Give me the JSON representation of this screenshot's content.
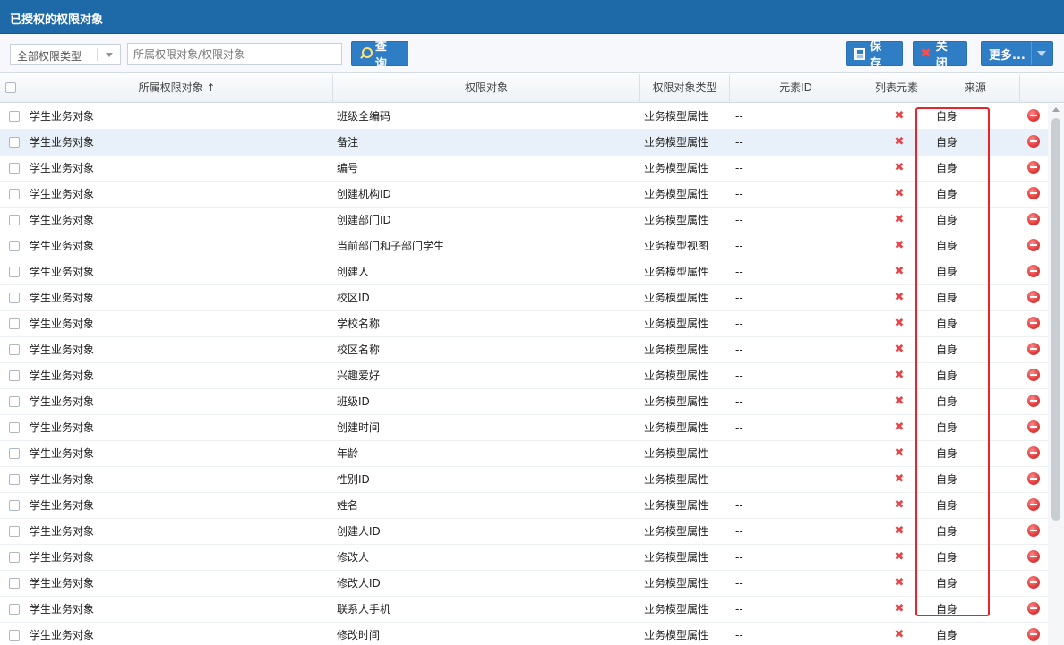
{
  "panel": {
    "title": "已授权的权限对象"
  },
  "toolbar": {
    "filter_select_value": "全部权限类型",
    "search_placeholder": "所属权限对象/权限对象",
    "query_label": "查 询",
    "save_label": "保 存",
    "close_label": "关 闭",
    "more_label": "更多..."
  },
  "columns": {
    "owner": "所属权限对象 ↑",
    "object": "权限对象",
    "type": "权限对象类型",
    "element_id": "元素ID",
    "list_element": "列表元素",
    "source": "来源"
  },
  "rows": [
    {
      "owner": "学生业务对象",
      "object": "班级全编码",
      "type": "业务模型属性",
      "element_id": "--",
      "list_element": "✖",
      "source": "自身"
    },
    {
      "owner": "学生业务对象",
      "object": "备注",
      "type": "业务模型属性",
      "element_id": "--",
      "list_element": "✖",
      "source": "自身"
    },
    {
      "owner": "学生业务对象",
      "object": "编号",
      "type": "业务模型属性",
      "element_id": "--",
      "list_element": "✖",
      "source": "自身"
    },
    {
      "owner": "学生业务对象",
      "object": "创建机构ID",
      "type": "业务模型属性",
      "element_id": "--",
      "list_element": "✖",
      "source": "自身"
    },
    {
      "owner": "学生业务对象",
      "object": "创建部门ID",
      "type": "业务模型属性",
      "element_id": "--",
      "list_element": "✖",
      "source": "自身"
    },
    {
      "owner": "学生业务对象",
      "object": "当前部门和子部门学生",
      "type": "业务模型视图",
      "element_id": "--",
      "list_element": "✖",
      "source": "自身"
    },
    {
      "owner": "学生业务对象",
      "object": "创建人",
      "type": "业务模型属性",
      "element_id": "--",
      "list_element": "✖",
      "source": "自身"
    },
    {
      "owner": "学生业务对象",
      "object": "校区ID",
      "type": "业务模型属性",
      "element_id": "--",
      "list_element": "✖",
      "source": "自身"
    },
    {
      "owner": "学生业务对象",
      "object": "学校名称",
      "type": "业务模型属性",
      "element_id": "--",
      "list_element": "✖",
      "source": "自身"
    },
    {
      "owner": "学生业务对象",
      "object": "校区名称",
      "type": "业务模型属性",
      "element_id": "--",
      "list_element": "✖",
      "source": "自身"
    },
    {
      "owner": "学生业务对象",
      "object": "兴趣爱好",
      "type": "业务模型属性",
      "element_id": "--",
      "list_element": "✖",
      "source": "自身"
    },
    {
      "owner": "学生业务对象",
      "object": "班级ID",
      "type": "业务模型属性",
      "element_id": "--",
      "list_element": "✖",
      "source": "自身"
    },
    {
      "owner": "学生业务对象",
      "object": "创建时间",
      "type": "业务模型属性",
      "element_id": "--",
      "list_element": "✖",
      "source": "自身"
    },
    {
      "owner": "学生业务对象",
      "object": "年龄",
      "type": "业务模型属性",
      "element_id": "--",
      "list_element": "✖",
      "source": "自身"
    },
    {
      "owner": "学生业务对象",
      "object": "性别ID",
      "type": "业务模型属性",
      "element_id": "--",
      "list_element": "✖",
      "source": "自身"
    },
    {
      "owner": "学生业务对象",
      "object": "姓名",
      "type": "业务模型属性",
      "element_id": "--",
      "list_element": "✖",
      "source": "自身"
    },
    {
      "owner": "学生业务对象",
      "object": "创建人ID",
      "type": "业务模型属性",
      "element_id": "--",
      "list_element": "✖",
      "source": "自身"
    },
    {
      "owner": "学生业务对象",
      "object": "修改人",
      "type": "业务模型属性",
      "element_id": "--",
      "list_element": "✖",
      "source": "自身"
    },
    {
      "owner": "学生业务对象",
      "object": "修改人ID",
      "type": "业务模型属性",
      "element_id": "--",
      "list_element": "✖",
      "source": "自身"
    },
    {
      "owner": "学生业务对象",
      "object": "联系人手机",
      "type": "业务模型属性",
      "element_id": "--",
      "list_element": "✖",
      "source": "自身"
    },
    {
      "owner": "学生业务对象",
      "object": "修改时间",
      "type": "业务模型属性",
      "element_id": "--",
      "list_element": "✖",
      "source": "自身"
    }
  ]
}
